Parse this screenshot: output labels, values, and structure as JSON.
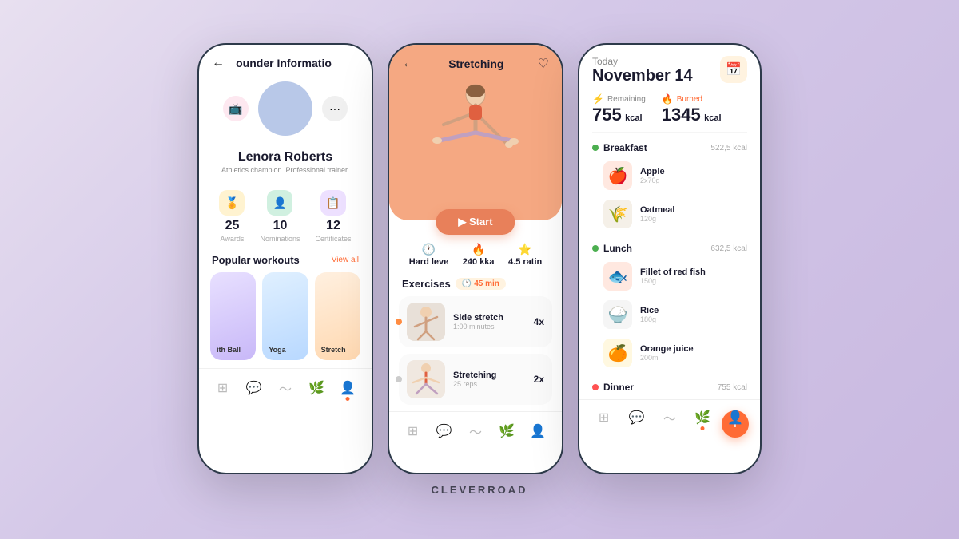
{
  "brand": "CLEVERROAD",
  "phone_left": {
    "header_title": "ounder Informatio",
    "back_icon": "←",
    "profile_name": "Lenora Roberts",
    "profile_bio": "Athletics champion. Professional trainer.",
    "stats": [
      {
        "icon": "🏅",
        "number": "25",
        "label": "Awards",
        "bg": "yellow"
      },
      {
        "icon": "👤",
        "number": "10",
        "label": "Nominations",
        "bg": "green"
      },
      {
        "icon": "📋",
        "number": "12",
        "label": "Certificates",
        "bg": "purple"
      }
    ],
    "popular_title": "Popular workouts",
    "view_all": "View all",
    "workouts": [
      {
        "label": "ith Ball",
        "bg": "ball"
      },
      {
        "label": "Yoga",
        "bg": "yoga"
      },
      {
        "label": "Stretch",
        "bg": "stretch"
      }
    ],
    "nav_icons": [
      "⊞",
      "💬",
      "〜",
      "🌿",
      "👤"
    ]
  },
  "phone_middle": {
    "title": "Stretching",
    "back_icon": "←",
    "heart_icon": "♡",
    "start_label": "▶ Start",
    "stats": [
      {
        "icon": "🕐",
        "label": "Hard leve",
        "val": ""
      },
      {
        "icon": "🔥",
        "label": "240 kka",
        "val": ""
      },
      {
        "icon": "⭐",
        "label": "4.5 ratin",
        "val": ""
      }
    ],
    "exercises_title": "Exercises",
    "timer_icon": "🕐",
    "timer_label": "45 min",
    "exercises": [
      {
        "name": "Side stretch",
        "sub": "1:00 minutes",
        "reps": "4x",
        "dot": "orange"
      },
      {
        "name": "Stretching",
        "sub": "25 reps",
        "reps": "2x",
        "dot": "gray"
      }
    ]
  },
  "phone_right": {
    "date_today": "Today",
    "date_main": "November 14",
    "cal_icon": "📅",
    "remaining_label": "Remaining",
    "remaining_icon": "⚡",
    "remaining_val": "755",
    "remaining_unit": "kcal",
    "burned_label": "Burned",
    "burned_icon": "🔥",
    "burned_val": "1345",
    "burned_unit": "kcal",
    "meals": [
      {
        "name": "Breakfast",
        "kcal": "522,5 kcal",
        "dot": "green",
        "foods": [
          {
            "name": "Apple",
            "amount": "2x70g",
            "emoji": "🍎",
            "bg": "apple"
          },
          {
            "name": "Oatmeal",
            "amount": "120g",
            "emoji": "🌾",
            "bg": "oatmeal"
          }
        ]
      },
      {
        "name": "Lunch",
        "kcal": "632,5 kcal",
        "dot": "green",
        "foods": [
          {
            "name": "Fillet of red fish",
            "amount": "150g",
            "emoji": "🐟",
            "bg": "fish"
          },
          {
            "name": "Rice",
            "amount": "180g",
            "emoji": "🍚",
            "bg": "rice"
          },
          {
            "name": "Orange juice",
            "amount": "200ml",
            "emoji": "🍊",
            "bg": "juice"
          }
        ]
      },
      {
        "name": "Dinner",
        "kcal": "755 kcal",
        "dot": "red",
        "foods": []
      }
    ],
    "add_icon": "+",
    "nav_icons": [
      "⊞",
      "💬",
      "〜",
      "🌿",
      "👤"
    ]
  }
}
